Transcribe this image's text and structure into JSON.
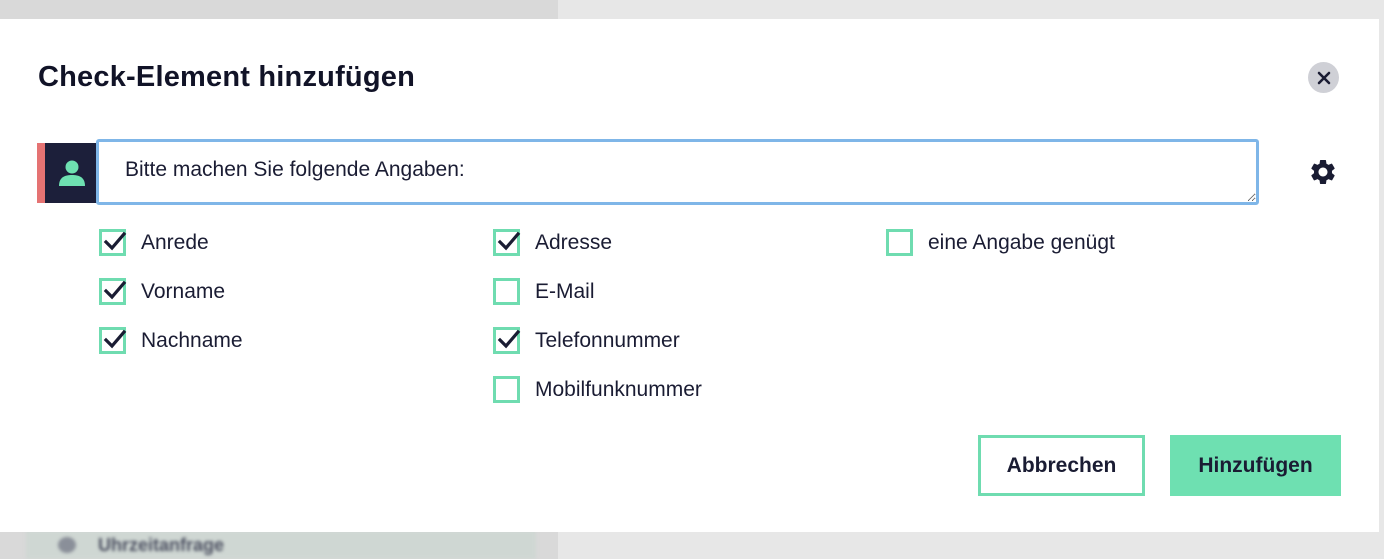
{
  "background": {
    "list_item_label": "Uhrzeitanfrage"
  },
  "dialog": {
    "title": "Check-Element hinzufügen",
    "close_icon": "close-icon",
    "message": {
      "avatar_icon": "user-icon",
      "value": "Bitte machen Sie folgende Angaben:",
      "settings_icon": "gear-icon"
    },
    "options": [
      {
        "id": "anrede",
        "label": "Anrede",
        "checked": true
      },
      {
        "id": "vorname",
        "label": "Vorname",
        "checked": true
      },
      {
        "id": "nachname",
        "label": "Nachname",
        "checked": true
      },
      {
        "id": "adresse",
        "label": "Adresse",
        "checked": true
      },
      {
        "id": "email",
        "label": "E-Mail",
        "checked": false
      },
      {
        "id": "telefonnummer",
        "label": "Telefonnummer",
        "checked": true
      },
      {
        "id": "mobilfunknummer",
        "label": "Mobilfunknummer",
        "checked": false
      },
      {
        "id": "eine-angabe",
        "label": "eine Angabe genügt",
        "checked": false
      }
    ],
    "buttons": {
      "cancel": "Abbrechen",
      "add": "Hinzufügen"
    }
  },
  "colors": {
    "accent_green": "#6ee0b1",
    "accent_red": "#e57373",
    "dark_navy": "#1c1f3a",
    "focus_blue": "#7fb6e8"
  }
}
